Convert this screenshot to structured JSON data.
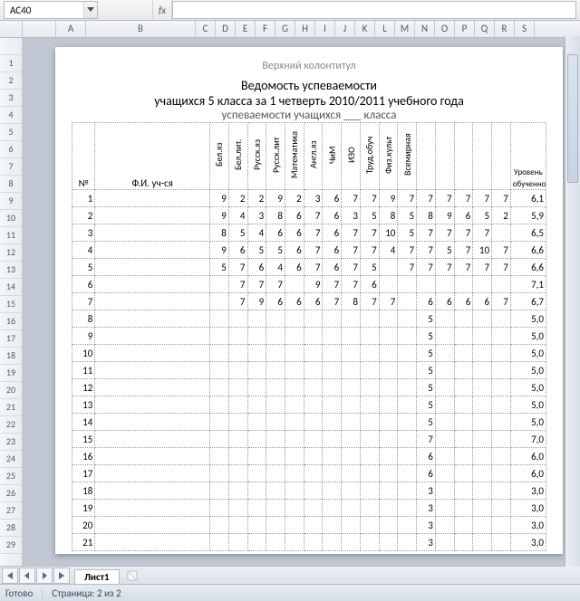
{
  "namebox": {
    "value": "AC40"
  },
  "fx_label": "fx",
  "columns": [
    "A",
    "B",
    "C",
    "D",
    "E",
    "F",
    "G",
    "H",
    "I",
    "J",
    "K",
    "L",
    "M",
    "N",
    "O",
    "P",
    "Q",
    "R",
    "S"
  ],
  "row_numbers": [
    "",
    "1",
    "2",
    "3",
    "4",
    "5",
    "6",
    "7",
    "8",
    "9",
    "10",
    "11",
    "12",
    "13",
    "14",
    "15",
    "16",
    "17",
    "18",
    "19",
    "20",
    "21",
    "22",
    "23",
    "24",
    "25",
    "26",
    "27",
    "28",
    "29"
  ],
  "running_head": "Верхний колонтитул",
  "title1": "Ведомость успеваемости",
  "title2": "учащихся 5 класса за 1 четверть  2010/2011 учебного года",
  "title3": "успеваемости учащихся ___ класса",
  "head": {
    "no": "№",
    "name": "Ф.И. уч-ся",
    "subjects": [
      "Бел.яз",
      "Бел.лит.",
      "Русск.яз",
      "Русск.лит",
      "Математика",
      "Англ.яз",
      "ЧиМ",
      "ИЗО",
      "Труд.обуч",
      "Физ.культ",
      "Всемирная"
    ],
    "extra_blank_cols": 5,
    "level": "Уровень обученности"
  },
  "rows": [
    {
      "n": "1",
      "g": [
        "9",
        "2",
        "2",
        "9",
        "2",
        "3",
        "6",
        "7",
        "7",
        "9",
        "7",
        "7",
        "7",
        "7",
        "7",
        "7"
      ],
      "lvl": "6,1"
    },
    {
      "n": "2",
      "g": [
        "9",
        "4",
        "3",
        "8",
        "6",
        "7",
        "6",
        "3",
        "5",
        "8",
        "5",
        "8",
        "9",
        "6",
        "5",
        "2"
      ],
      "lvl": "5,9"
    },
    {
      "n": "3",
      "g": [
        "8",
        "5",
        "4",
        "6",
        "6",
        "7",
        "6",
        "7",
        "7",
        "10",
        "5",
        "7",
        "7",
        "7",
        "7",
        ""
      ],
      "lvl": "6,5"
    },
    {
      "n": "4",
      "g": [
        "9",
        "6",
        "5",
        "5",
        "6",
        "7",
        "6",
        "7",
        "7",
        "4",
        "7",
        "7",
        "5",
        "7",
        "10",
        "7"
      ],
      "lvl": "6,6"
    },
    {
      "n": "5",
      "g": [
        "5",
        "7",
        "6",
        "4",
        "6",
        "7",
        "6",
        "7",
        "5",
        "",
        "7",
        "7",
        "7",
        "7",
        "7",
        "7"
      ],
      "lvl": "6,6"
    },
    {
      "n": "6",
      "g": [
        "",
        "7",
        "7",
        "7",
        "",
        "9",
        "7",
        "7",
        "6",
        "",
        "",
        "",
        "",
        "",
        "",
        ""
      ],
      "lvl": "7,1"
    },
    {
      "n": "7",
      "g": [
        "",
        "7",
        "9",
        "6",
        "6",
        "6",
        "7",
        "8",
        "7",
        "7",
        "",
        "6",
        "6",
        "6",
        "6",
        "7"
      ],
      "lvl": "6,7"
    },
    {
      "n": "8",
      "g": [
        "",
        "",
        "",
        "",
        "",
        "",
        "",
        "",
        "",
        "",
        "",
        "5",
        "",
        "",
        "",
        ""
      ],
      "lvl": "5,0"
    },
    {
      "n": "9",
      "g": [
        "",
        "",
        "",
        "",
        "",
        "",
        "",
        "",
        "",
        "",
        "",
        "5",
        "",
        "",
        "",
        ""
      ],
      "lvl": "5,0"
    },
    {
      "n": "10",
      "g": [
        "",
        "",
        "",
        "",
        "",
        "",
        "",
        "",
        "",
        "",
        "",
        "5",
        "",
        "",
        "",
        ""
      ],
      "lvl": "5,0"
    },
    {
      "n": "11",
      "g": [
        "",
        "",
        "",
        "",
        "",
        "",
        "",
        "",
        "",
        "",
        "",
        "5",
        "",
        "",
        "",
        ""
      ],
      "lvl": "5,0"
    },
    {
      "n": "12",
      "g": [
        "",
        "",
        "",
        "",
        "",
        "",
        "",
        "",
        "",
        "",
        "",
        "5",
        "",
        "",
        "",
        ""
      ],
      "lvl": "5,0"
    },
    {
      "n": "13",
      "g": [
        "",
        "",
        "",
        "",
        "",
        "",
        "",
        "",
        "",
        "",
        "",
        "5",
        "",
        "",
        "",
        ""
      ],
      "lvl": "5,0"
    },
    {
      "n": "14",
      "g": [
        "",
        "",
        "",
        "",
        "",
        "",
        "",
        "",
        "",
        "",
        "",
        "5",
        "",
        "",
        "",
        ""
      ],
      "lvl": "5,0"
    },
    {
      "n": "15",
      "g": [
        "",
        "",
        "",
        "",
        "",
        "",
        "",
        "",
        "",
        "",
        "",
        "7",
        "",
        "",
        "",
        ""
      ],
      "lvl": "7,0"
    },
    {
      "n": "16",
      "g": [
        "",
        "",
        "",
        "",
        "",
        "",
        "",
        "",
        "",
        "",
        "",
        "6",
        "",
        "",
        "",
        ""
      ],
      "lvl": "6,0"
    },
    {
      "n": "17",
      "g": [
        "",
        "",
        "",
        "",
        "",
        "",
        "",
        "",
        "",
        "",
        "",
        "6",
        "",
        "",
        "",
        ""
      ],
      "lvl": "6,0"
    },
    {
      "n": "18",
      "g": [
        "",
        "",
        "",
        "",
        "",
        "",
        "",
        "",
        "",
        "",
        "",
        "3",
        "",
        "",
        "",
        ""
      ],
      "lvl": "3,0"
    },
    {
      "n": "19",
      "g": [
        "",
        "",
        "",
        "",
        "",
        "",
        "",
        "",
        "",
        "",
        "",
        "3",
        "",
        "",
        "",
        ""
      ],
      "lvl": "3,0"
    },
    {
      "n": "20",
      "g": [
        "",
        "",
        "",
        "",
        "",
        "",
        "",
        "",
        "",
        "",
        "",
        "3",
        "",
        "",
        "",
        ""
      ],
      "lvl": "3,0"
    },
    {
      "n": "21",
      "g": [
        "",
        "",
        "",
        "",
        "",
        "",
        "",
        "",
        "",
        "",
        "",
        "3",
        "",
        "",
        "",
        ""
      ],
      "lvl": "3,0"
    }
  ],
  "sheet_tab": "Лист1",
  "status": {
    "ready": "Готово",
    "page": "Страница: 2 из 2"
  }
}
